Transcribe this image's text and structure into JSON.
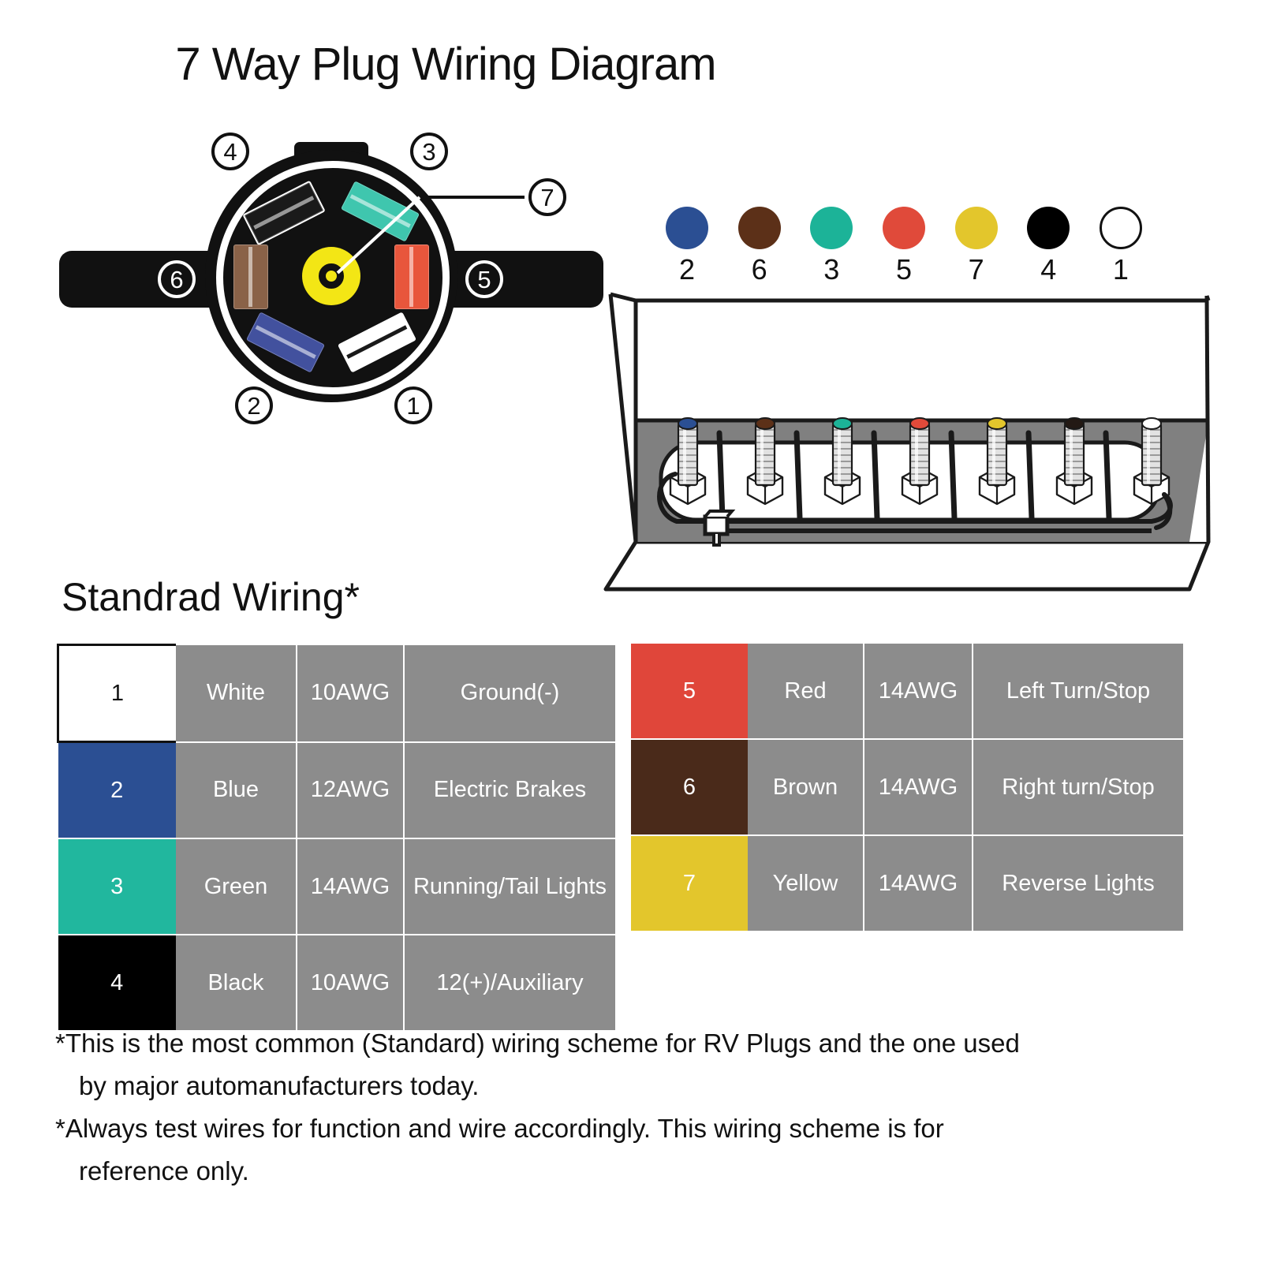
{
  "title": "7 Way Plug Wiring Diagram",
  "plug": {
    "callouts": [
      {
        "id": "4",
        "label": "4"
      },
      {
        "id": "3",
        "label": "3"
      },
      {
        "id": "7",
        "label": "7"
      },
      {
        "id": "6",
        "label": "6"
      },
      {
        "id": "5",
        "label": "5"
      },
      {
        "id": "2",
        "label": "2"
      },
      {
        "id": "1",
        "label": "1"
      }
    ],
    "contacts": [
      {
        "pin": "4",
        "color_name": "Black",
        "hex": "#111111",
        "position": "upper-left"
      },
      {
        "pin": "3",
        "color_name": "Green",
        "hex": "#3FC6AE",
        "position": "upper-right"
      },
      {
        "pin": "6",
        "color_name": "Brown",
        "hex": "#8A6248",
        "position": "left"
      },
      {
        "pin": "5",
        "color_name": "Red",
        "hex": "#E8563C",
        "position": "right"
      },
      {
        "pin": "2",
        "color_name": "Blue",
        "hex": "#42519E",
        "position": "lower-left"
      },
      {
        "pin": "1",
        "color_name": "White",
        "hex": "#FFFFFF",
        "position": "lower-right"
      },
      {
        "pin": "7",
        "color_name": "Yellow",
        "hex": "#F3E615",
        "position": "center"
      }
    ]
  },
  "color_legend": [
    {
      "number": "2",
      "color_name": "Blue",
      "hex": "#2B4F93",
      "outlined": false
    },
    {
      "number": "6",
      "color_name": "Brown",
      "hex": "#5C3018",
      "outlined": false
    },
    {
      "number": "3",
      "color_name": "Green",
      "hex": "#1CB398",
      "outlined": false
    },
    {
      "number": "5",
      "color_name": "Red",
      "hex": "#E04A3A",
      "outlined": false
    },
    {
      "number": "7",
      "color_name": "Yellow",
      "hex": "#E3C62C",
      "outlined": false
    },
    {
      "number": "4",
      "color_name": "Black",
      "hex": "#000000",
      "outlined": false
    },
    {
      "number": "1",
      "color_name": "White",
      "hex": "#FFFFFF",
      "outlined": true
    }
  ],
  "junction_box": {
    "terminal_caps": [
      {
        "color_name": "Blue",
        "hex": "#2B4F93"
      },
      {
        "color_name": "Brown",
        "hex": "#5C3018"
      },
      {
        "color_name": "Green",
        "hex": "#1CB398"
      },
      {
        "color_name": "Red",
        "hex": "#E04A3A"
      },
      {
        "color_name": "Yellow",
        "hex": "#E3C62C"
      },
      {
        "color_name": "Black",
        "hex": "#231914"
      },
      {
        "color_name": "White",
        "hex": "#FFFFFF"
      }
    ]
  },
  "wiring_section": {
    "heading": "Standrad Wiring*"
  },
  "wiring_table_left": [
    {
      "number": "1",
      "swatch_hex": "#FFFFFF",
      "number_text_color": "#111111",
      "color": "White",
      "awg": "10AWG",
      "function": "Ground(-)"
    },
    {
      "number": "2",
      "swatch_hex": "#2B4F93",
      "number_text_color": "#FFFFFF",
      "color": "Blue",
      "awg": "12AWG",
      "function": "Electric Brakes"
    },
    {
      "number": "3",
      "swatch_hex": "#21B79E",
      "number_text_color": "#FFFFFF",
      "color": "Green",
      "awg": "14AWG",
      "function": "Running/Tail Lights"
    },
    {
      "number": "4",
      "swatch_hex": "#000000",
      "number_text_color": "#FFFFFF",
      "color": "Black",
      "awg": "10AWG",
      "function": "12(+)/Auxiliary"
    }
  ],
  "wiring_table_right": [
    {
      "number": "5",
      "swatch_hex": "#E0463A",
      "number_text_color": "#FFFFFF",
      "color": "Red",
      "awg": "14AWG",
      "function": "Left Turn/Stop"
    },
    {
      "number": "6",
      "swatch_hex": "#4A2A1A",
      "number_text_color": "#FFFFFF",
      "color": "Brown",
      "awg": "14AWG",
      "function": "Right turn/Stop"
    },
    {
      "number": "7",
      "swatch_hex": "#E3C62C",
      "number_text_color": "#FFFFFF",
      "color": "Yellow",
      "awg": "14AWG",
      "function": "Reverse Lights"
    }
  ],
  "footnotes": [
    {
      "line1": "*This is the most common (Standard) wiring scheme for RV Plugs and the one used",
      "line2": "by  major automanufacturers today."
    },
    {
      "line1": "*Always test wires for function and wire accordingly. This  wiring scheme is for",
      "line2": "reference only."
    }
  ]
}
